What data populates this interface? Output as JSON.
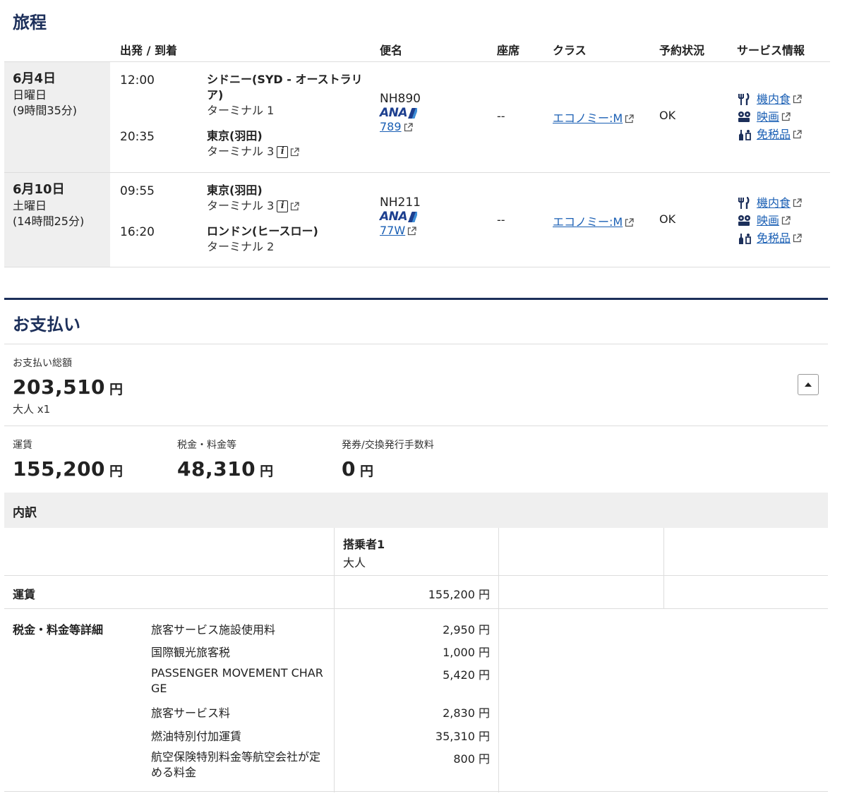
{
  "itinerary": {
    "title": "旅程",
    "headers": {
      "dep_arr": "出発 / 到着",
      "flight": "便名",
      "seat": "座席",
      "class": "クラス",
      "status": "予約状況",
      "services": "サービス情報"
    },
    "segments": [
      {
        "date": "6月4日",
        "weekday": "日曜日",
        "duration": "(9時間35分)",
        "dep_time": "12:00",
        "dep_place": "シドニー(SYD - オーストラリア)",
        "dep_terminal": "ターミナル 1",
        "arr_time": "20:35",
        "arr_place": "東京(羽田)",
        "arr_terminal": "ターミナル 3",
        "flight_no": "NH890",
        "airline": "ANA",
        "aircraft": "789",
        "seat": "--",
        "cabin_class": "エコノミー:M",
        "status": "OK",
        "services": [
          "機内食",
          "映画",
          "免税品"
        ]
      },
      {
        "date": "6月10日",
        "weekday": "土曜日",
        "duration": "(14時間25分)",
        "dep_time": "09:55",
        "dep_place": "東京(羽田)",
        "dep_terminal": "ターミナル 3",
        "arr_time": "16:20",
        "arr_place": "ロンドン(ヒースロー)",
        "arr_terminal": "ターミナル 2",
        "flight_no": "NH211",
        "airline": "ANA",
        "aircraft": "77W",
        "seat": "--",
        "cabin_class": "エコノミー:M",
        "status": "OK",
        "services": [
          "機内食",
          "映画",
          "免税品"
        ]
      }
    ]
  },
  "payment": {
    "title": "お支払い",
    "total_label": "お支払い総額",
    "total_amount": "203,510",
    "currency": "円",
    "passengers": "大人 x1",
    "fare_label": "運賃",
    "fare_amount": "155,200",
    "tax_label": "税金・料金等",
    "tax_amount": "48,310",
    "fee_label": "発券/交換発行手数料",
    "fee_amount": "0",
    "breakdown": {
      "title": "内訳",
      "passenger_header": "搭乗者1",
      "passenger_type": "大人",
      "fare_row_label": "運賃",
      "fare_row_value": "155,200 円",
      "tax_detail_label": "税金・料金等詳細",
      "tax_items": [
        {
          "name": "旅客サービス施設使用料",
          "value": "2,950 円"
        },
        {
          "name": "国際観光旅客税",
          "value": "1,000 円"
        },
        {
          "name": "PASSENGER MOVEMENT CHARGE",
          "value": "5,420 円"
        },
        {
          "name": "旅客サービス料",
          "value": "2,830 円"
        },
        {
          "name": "燃油特別付加運賃",
          "value": "35,310 円"
        },
        {
          "name": "航空保険特別料金等航空会社が定める料金",
          "value": "800 円"
        }
      ]
    }
  },
  "colors": {
    "accent": "#1c2f5a",
    "link": "#1a5fb4",
    "date_bg": "#efefef"
  }
}
